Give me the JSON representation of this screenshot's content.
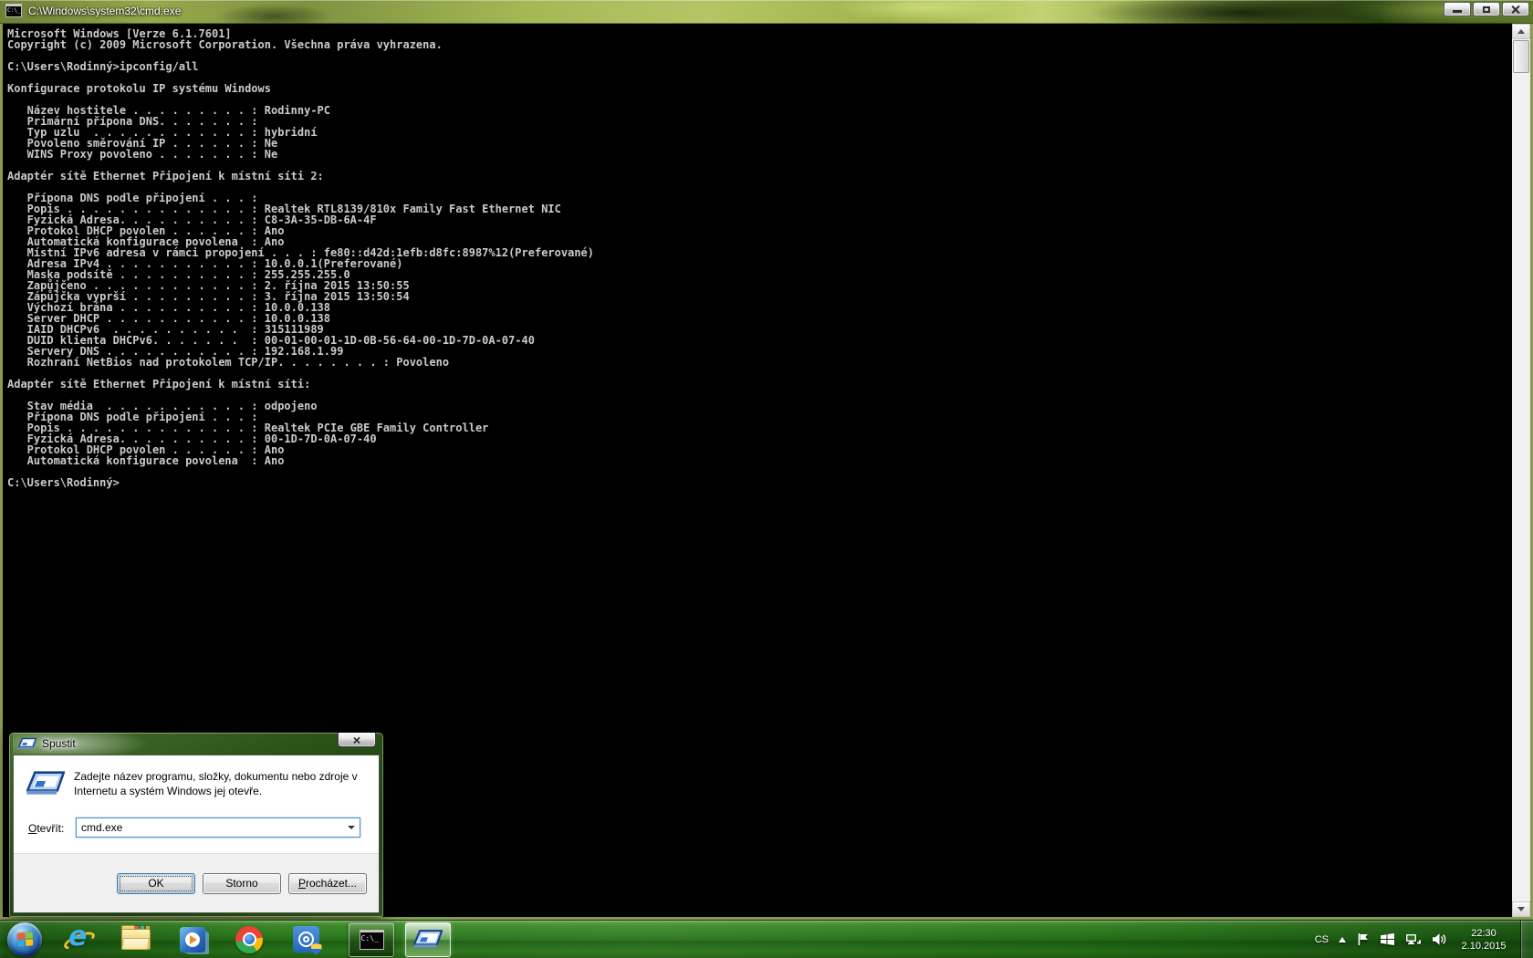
{
  "console": {
    "title": "C:\\Windows\\system32\\cmd.exe",
    "lines": [
      "Microsoft Windows [Verze 6.1.7601]",
      "Copyright (c) 2009 Microsoft Corporation. Všechna práva vyhrazena.",
      "",
      "C:\\Users\\Rodinný>ipconfig/all",
      "",
      "Konfigurace protokolu IP systému Windows",
      "",
      "   Název hostitele . . . . . . . . . : Rodinny-PC",
      "   Primární přípona DNS. . . . . . . :",
      "   Typ uzlu  . . . . . . . . . . . . : hybridní",
      "   Povoleno směrování IP . . . . . . : Ne",
      "   WINS Proxy povoleno . . . . . . . : Ne",
      "",
      "Adaptér sítě Ethernet Připojení k místní síti 2:",
      "",
      "   Přípona DNS podle připojení . . . :",
      "   Popis . . . . . . . . . . . . . . : Realtek RTL8139/810x Family Fast Ethernet NIC",
      "   Fyzická Adresa. . . . . . . . . . : C8-3A-35-DB-6A-4F",
      "   Protokol DHCP povolen . . . . . . : Ano",
      "   Automatická konfigurace povolena  : Ano",
      "   Místní IPv6 adresa v rámci propojení . . . : fe80::d42d:1efb:d8fc:8987%12(Preferované)",
      "   Adresa IPv4 . . . . . . . . . . . : 10.0.0.1(Preferované)",
      "   Maska podsítě . . . . . . . . . . : 255.255.255.0",
      "   Zapůjčeno . . . . . . . . . . . . : 2. října 2015 13:50:55",
      "   Zápůjčka vyprší . . . . . . . . . : 3. října 2015 13:50:54",
      "   Výchozí brána . . . . . . . . . . : 10.0.0.138",
      "   Server DHCP . . . . . . . . . . . : 10.0.0.138",
      "   IAID DHCPv6  . . . . . . . . . .  : 315111989",
      "   DUID klienta DHCPv6. . . . . . .  : 00-01-00-01-1D-0B-56-64-00-1D-7D-0A-07-40",
      "   Servery DNS . . . . . . . . . . . : 192.168.1.99",
      "   Rozhraní NetBios nad protokolem TCP/IP. . . . . . . . : Povoleno",
      "",
      "Adaptér sítě Ethernet Připojení k místní síti:",
      "",
      "   Stav média  . . . . . . . . . . . : odpojeno",
      "   Přípona DNS podle připojení . . . :",
      "   Popis . . . . . . . . . . . . . . : Realtek PCIe GBE Family Controller",
      "   Fyzická Adresa. . . . . . . . . . : 00-1D-7D-0A-07-40",
      "   Protokol DHCP povolen . . . . . . : Ano",
      "   Automatická konfigurace povolena  : Ano",
      "",
      "C:\\Users\\Rodinný>"
    ],
    "icon_label": "C:\\_"
  },
  "run_dialog": {
    "title": "Spustit",
    "message_line1": "Zadejte název programu, složky, dokumentu nebo zdroje v",
    "message_line2": "Internetu a systém Windows jej otevře.",
    "open_label_accel": "O",
    "open_label_rest": "tevřít:",
    "open_value": "cmd.exe",
    "ok_label": "OK",
    "cancel_label": "Storno",
    "browse_label_accel": "P",
    "browse_label_rest": "rocházet..."
  },
  "taskbar": {
    "language_indicator": "CS",
    "clock_time": "22:30",
    "clock_date": "2.10.2015"
  }
}
